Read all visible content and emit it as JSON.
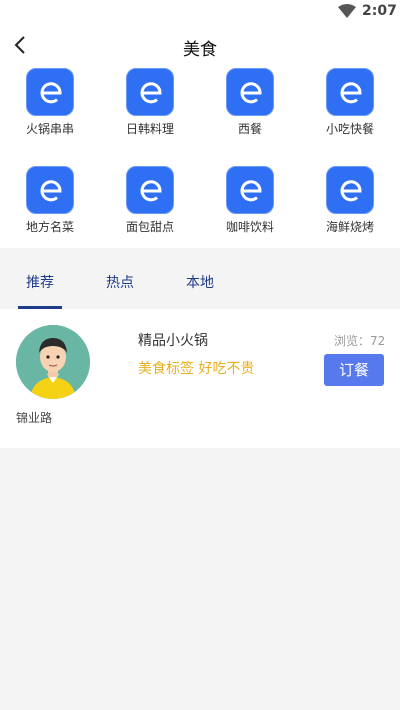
{
  "status_bar": {
    "time": "2:07",
    "icons": [
      "wifi-icon"
    ]
  },
  "header": {
    "title": "美食",
    "back_icon": "chevron-left-icon"
  },
  "categories": [
    {
      "label": "火锅串串",
      "icon": "e-logo-icon"
    },
    {
      "label": "日韩料理",
      "icon": "e-logo-icon"
    },
    {
      "label": "西餐",
      "icon": "e-logo-icon"
    },
    {
      "label": "小吃快餐",
      "icon": "e-logo-icon"
    },
    {
      "label": "地方名菜",
      "icon": "e-logo-icon"
    },
    {
      "label": "面包甜点",
      "icon": "e-logo-icon"
    },
    {
      "label": "咖啡饮料",
      "icon": "e-logo-icon"
    },
    {
      "label": "海鲜烧烤",
      "icon": "e-logo-icon"
    }
  ],
  "tabs": [
    {
      "label": "推荐",
      "active": true
    },
    {
      "label": "热点",
      "active": false
    },
    {
      "label": "本地",
      "active": false
    }
  ],
  "listing": {
    "name": "精品小火锅",
    "views_label": "浏览：",
    "views_count": "72",
    "tags": "美食标签 好吃不贵",
    "order_label": "订餐",
    "address": "锦业路"
  },
  "colors": {
    "accent": "#1f3c88",
    "icon_bg": "#2f6ff3",
    "button": "#5779ee",
    "tag_text": "#e8b021",
    "avatar_bg": "#6ab6a4"
  }
}
